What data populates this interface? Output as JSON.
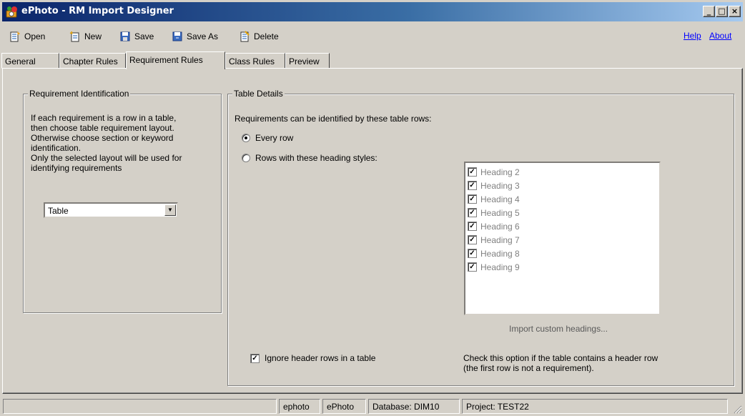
{
  "window": {
    "title": "ePhoto - RM Import Designer",
    "controls": {
      "minimize": "_",
      "maximize": "□",
      "close": "×"
    }
  },
  "toolbar": {
    "open_label": "Open",
    "new_label": "New",
    "save_label": "Save",
    "save_as_label": "Save As",
    "delete_label": "Delete",
    "help_label": "Help",
    "about_label": "About"
  },
  "tabs": {
    "general": "General",
    "chapter_rules": "Chapter Rules",
    "requirement_rules": "Requirement Rules",
    "class_rules": "Class Rules",
    "preview": "Preview"
  },
  "requirement_identification": {
    "legend": "Requirement Identification",
    "line1": "If each requirement is a row in a table,",
    "line2": "then choose table requirement layout.",
    "line3": "Otherwise choose section or keyword",
    "line4": "identification.",
    "line5": "Only the selected layout will be used for",
    "line6": "identifying requirements",
    "layout_value": "Table"
  },
  "table_details": {
    "legend": "Table Details",
    "intro": "Requirements can be identified by these table rows:",
    "option_every_row": "Every row",
    "option_heading_styles": "Rows with these heading styles:",
    "headings": [
      "Heading 2",
      "Heading 3",
      "Heading 4",
      "Heading 5",
      "Heading 6",
      "Heading 7",
      "Heading 8",
      "Heading 9"
    ],
    "import_custom": "Import custom headings...",
    "ignore_header_label": "Ignore header rows in a table",
    "note_line1": "Check this option if the table contains a header row",
    "note_line2": "(the first row is not a requirement)."
  },
  "statusbar": {
    "user": "ephoto",
    "app": "ePhoto",
    "database": "Database: DIM10",
    "project": "Project: TEST22"
  },
  "colors": {
    "titlebar_start": "#0a246a",
    "titlebar_end": "#a6caf0",
    "face": "#d4d0c8",
    "link": "#0000ff"
  }
}
